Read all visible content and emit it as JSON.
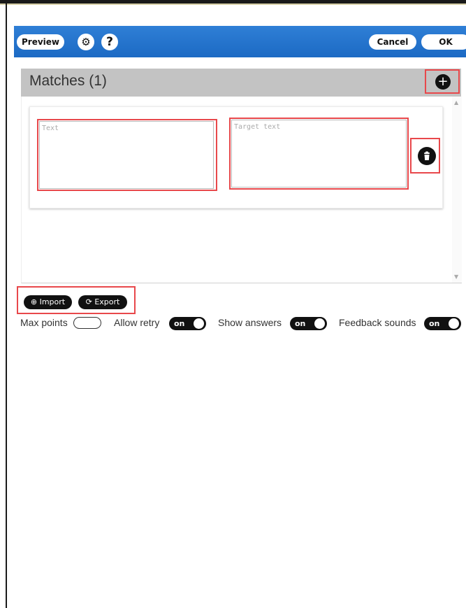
{
  "toolbar": {
    "preview_label": "Preview",
    "cancel_label": "Cancel",
    "ok_label": "OK",
    "settings_icon": "gear-icon",
    "help_glyph": "?",
    "color": "#1f6fca"
  },
  "matches": {
    "title": "Matches (1)",
    "add_glyph": "+",
    "items": [
      {
        "text_placeholder": "Text",
        "target_placeholder": "Target text",
        "text_value": "",
        "target_value": ""
      }
    ]
  },
  "io": {
    "import_label": "Import",
    "export_label": "Export",
    "import_icon": "import-icon",
    "export_icon": "export-icon"
  },
  "options": {
    "max_points_label": "Max points",
    "max_points_value": "",
    "allow_retry_label": "Allow retry",
    "allow_retry_state": "on",
    "show_answers_label": "Show answers",
    "show_answers_state": "on",
    "feedback_sounds_label": "Feedback sounds",
    "feedback_sounds_state": "on"
  },
  "colors": {
    "highlight": "#e8484b",
    "panel_header": "#c3c3c3"
  }
}
